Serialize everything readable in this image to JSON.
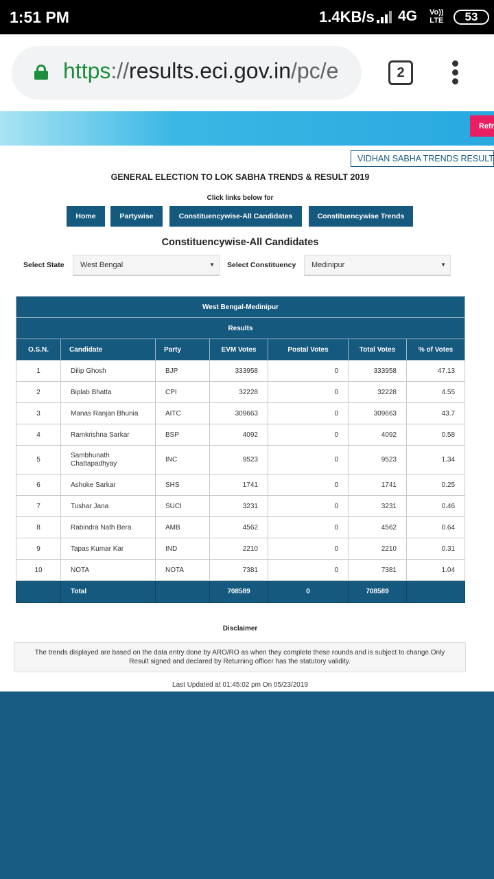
{
  "status_bar": {
    "time": "1:51 PM",
    "net_speed": "1.4KB/s",
    "network": "4G",
    "volte_top": "Vo))",
    "volte_bottom": "LTE",
    "battery": "53"
  },
  "browser": {
    "url_scheme": "https",
    "url_sep": "://",
    "url_host": "results.eci.gov.in",
    "url_path": "/pc/e",
    "tab_count": "2"
  },
  "banner": {
    "refresh_label": "Refresh"
  },
  "header": {
    "vidhan_sabha_link": "VIDHAN SABHA TRENDS RESULTS",
    "title": "GENERAL ELECTION TO LOK SABHA TRENDS & RESULT 2019",
    "click_text": "Click links below for"
  },
  "nav": {
    "home": "Home",
    "partywise": "Partywise",
    "constituencywise_all": "Constituencywise-All Candidates",
    "constituencywise_trends": "Constituencywise Trends"
  },
  "section_title": "Constituencywise-All Candidates",
  "filters": {
    "state_label": "Select State",
    "state_value": "West Bengal",
    "constituency_label": "Select Constituency",
    "constituency_value": "Medinipur"
  },
  "table": {
    "title": "West Bengal-Medinipur",
    "subtitle": "Results",
    "columns": [
      "O.S.N.",
      "Candidate",
      "Party",
      "EVM Votes",
      "Postal Votes",
      "Total Votes",
      "% of Votes"
    ],
    "rows": [
      {
        "osn": "1",
        "candidate": "Dilip Ghosh",
        "party": "BJP",
        "evm": "333958",
        "postal": "0",
        "total": "333958",
        "pct": "47.13"
      },
      {
        "osn": "2",
        "candidate": "Biplab Bhatta",
        "party": "CPI",
        "evm": "32228",
        "postal": "0",
        "total": "32228",
        "pct": "4.55"
      },
      {
        "osn": "3",
        "candidate": "Manas Ranjan Bhunia",
        "party": "AITC",
        "evm": "309663",
        "postal": "0",
        "total": "309663",
        "pct": "43.7"
      },
      {
        "osn": "4",
        "candidate": "Ramkrishna Sarkar",
        "party": "BSP",
        "evm": "4092",
        "postal": "0",
        "total": "4092",
        "pct": "0.58"
      },
      {
        "osn": "5",
        "candidate": "Sambhunath Chattapadhyay",
        "party": "INC",
        "evm": "9523",
        "postal": "0",
        "total": "9523",
        "pct": "1.34"
      },
      {
        "osn": "6",
        "candidate": "Ashoke Sarkar",
        "party": "SHS",
        "evm": "1741",
        "postal": "0",
        "total": "1741",
        "pct": "0.25"
      },
      {
        "osn": "7",
        "candidate": "Tushar Jana",
        "party": "SUCI",
        "evm": "3231",
        "postal": "0",
        "total": "3231",
        "pct": "0.46"
      },
      {
        "osn": "8",
        "candidate": "Rabindra Nath Bera",
        "party": "AMB",
        "evm": "4562",
        "postal": "0",
        "total": "4562",
        "pct": "0.64"
      },
      {
        "osn": "9",
        "candidate": "Tapas Kumar Kar",
        "party": "IND",
        "evm": "2210",
        "postal": "0",
        "total": "2210",
        "pct": "0.31"
      },
      {
        "osn": "10",
        "candidate": "NOTA",
        "party": "NOTA",
        "evm": "7381",
        "postal": "0",
        "total": "7381",
        "pct": "1.04"
      }
    ],
    "total": {
      "label": "Total",
      "evm": "708589",
      "postal": "0",
      "total": "708589"
    }
  },
  "disclaimer": {
    "title": "Disclaimer",
    "text": "The trends displayed are based on the data entry done by ARO/RO as when they complete these rounds and is subject to change.Only Result signed and declared by Returning officer has the statutory validity."
  },
  "last_updated": "Last Updated at 01:45:02 pm On 05/23/2019",
  "colors": {
    "primary": "#15597f",
    "refresh": "#e91e63",
    "secure_green": "#1e8e3e"
  }
}
